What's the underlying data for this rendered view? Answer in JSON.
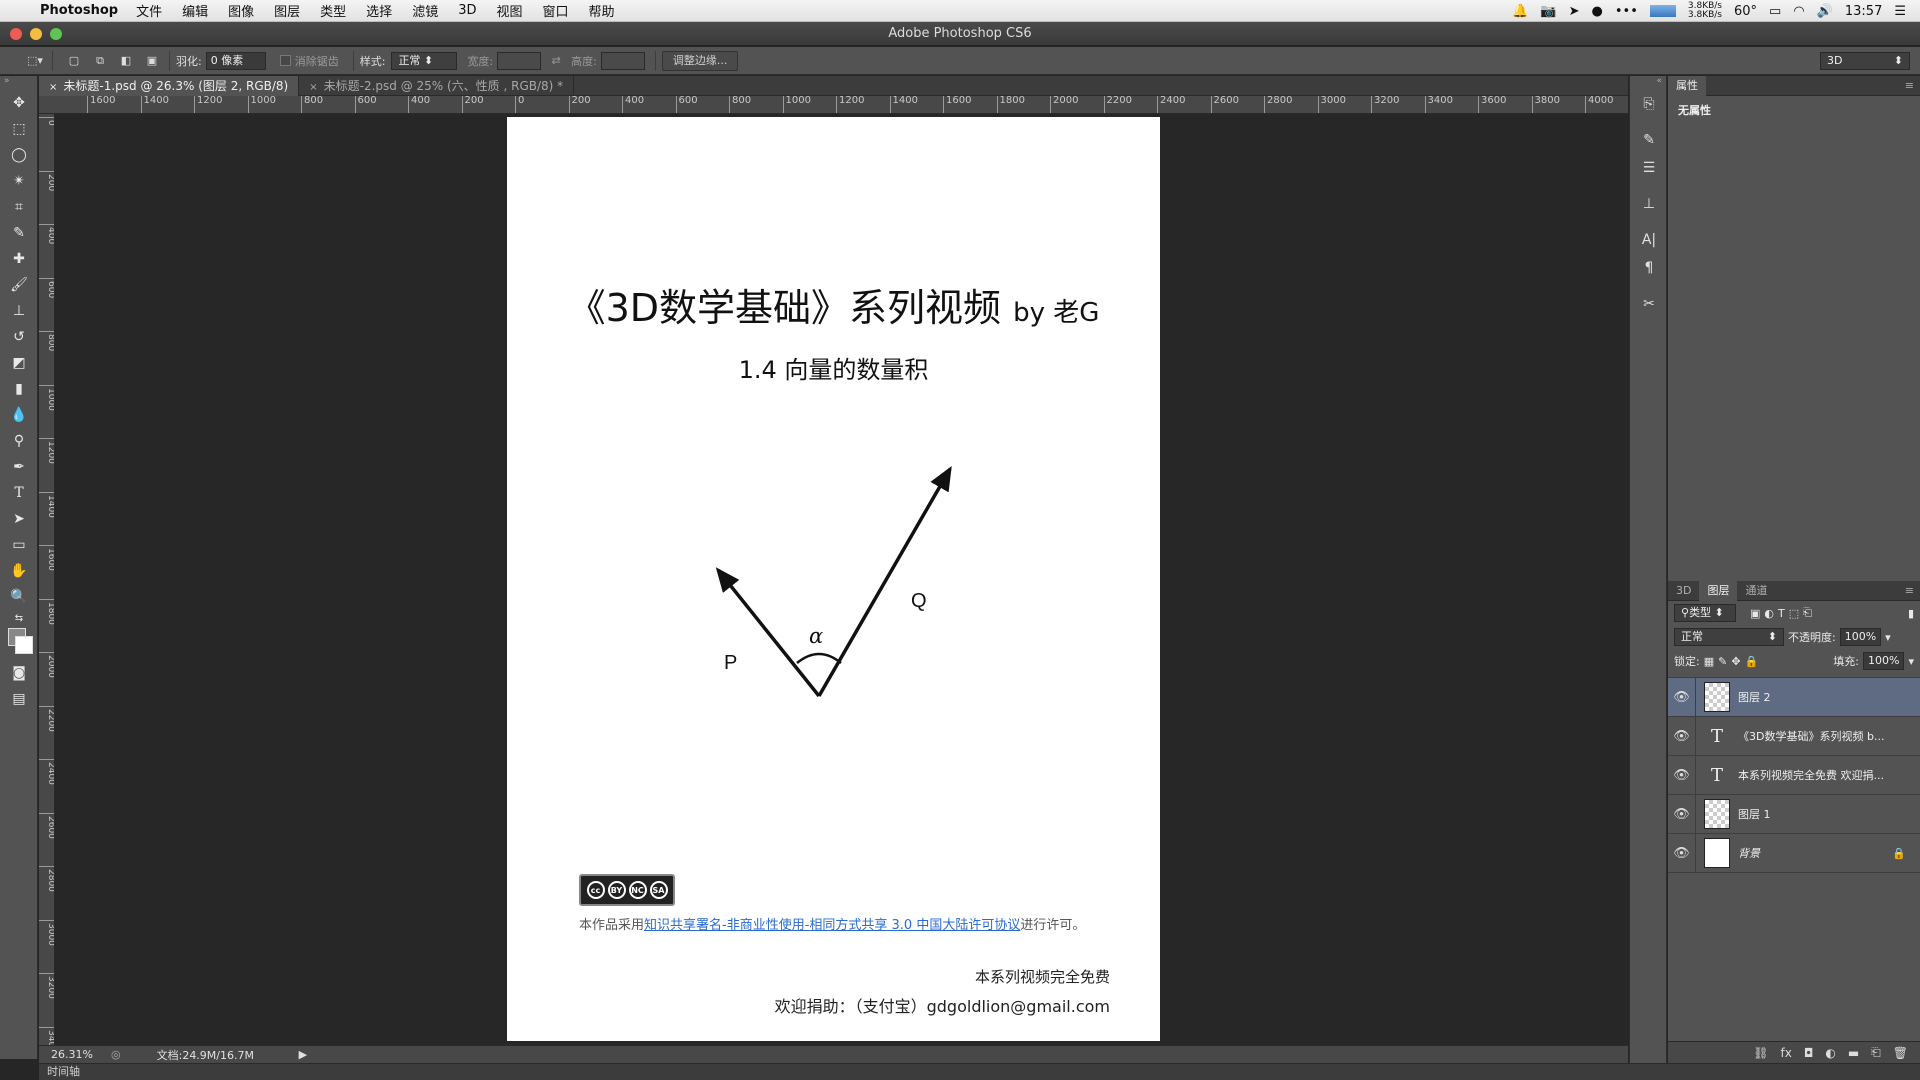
{
  "menubar": {
    "app_name": "Photoshop",
    "menus": [
      "文件",
      "编辑",
      "图像",
      "图层",
      "类型",
      "选择",
      "滤镜",
      "3D",
      "视图",
      "窗口",
      "帮助"
    ],
    "net_up": "3.8KB/s",
    "net_down": "3.8KB/s",
    "temperature": "60°",
    "time": "13:57"
  },
  "window": {
    "title": "Adobe Photoshop CS6"
  },
  "options_bar": {
    "feather_label": "羽化:",
    "feather_value": "0 像素",
    "antialias_label": "消除锯齿",
    "style_label": "样式:",
    "style_value": "正常",
    "width_label": "宽度:",
    "height_label": "高度:",
    "refine_edge_button": "调整边缘...",
    "workspace": "3D"
  },
  "tabs": [
    {
      "label": "未标题-1.psd @ 26.3% (图层 2, RGB/8)",
      "active": true
    },
    {
      "label": "未标题-2.psd @ 25% (六、性质 , RGB/8) *",
      "active": false
    }
  ],
  "ruler_h": [
    "1600",
    "1400",
    "1200",
    "1000",
    "800",
    "600",
    "400",
    "200",
    "0",
    "200",
    "400",
    "600",
    "800",
    "1000",
    "1200",
    "1400",
    "1600",
    "1800",
    "2000",
    "2200",
    "2400",
    "2600",
    "2800",
    "3000",
    "3200",
    "3400",
    "3600",
    "3800",
    "4000"
  ],
  "ruler_v": [
    "0",
    "200",
    "400",
    "600",
    "800",
    "1000",
    "1200",
    "1400",
    "1600",
    "1800",
    "2000",
    "2200",
    "2400",
    "2600",
    "2800",
    "3000",
    "3200",
    "3400"
  ],
  "document": {
    "title": "《3D数学基础》系列视频",
    "title_by": "by 老G",
    "subtitle": "1.4 向量的数量积",
    "diagram": {
      "label_p": "P",
      "label_q": "Q",
      "label_angle": "α"
    },
    "cc_badge": {
      "cc": "cc",
      "by": "BY",
      "nc": "NC",
      "sa": "SA"
    },
    "license_prefix": "本作品采用",
    "license_link": "知识共享署名-非商业性使用-相同方式共享 3.0 中国大陆许可协议",
    "license_suffix": "进行许可。",
    "free_text": "本系列视频完全免费",
    "donate_text": "欢迎捐助：（支付宝）gdgoldlion@gmail.com"
  },
  "status_bar": {
    "zoom": "26.31%",
    "doc_size": "文档:24.9M/16.7M"
  },
  "timeline": {
    "label": "时间轴"
  },
  "properties_panel": {
    "tab": "属性",
    "empty_text": "无属性"
  },
  "layers_panel": {
    "tabs": [
      "3D",
      "图层",
      "通道"
    ],
    "active_tab": "图层",
    "filter_kind": "类型",
    "blend_mode": "正常",
    "opacity_label": "不透明度:",
    "opacity_value": "100%",
    "lock_label": "锁定:",
    "fill_label": "填充:",
    "fill_value": "100%",
    "layers": [
      {
        "name": "图层 2",
        "kind": "pixel",
        "selected": true
      },
      {
        "name": "《3D数学基础》系列视频 b...",
        "kind": "text",
        "selected": false
      },
      {
        "name": "本系列视频完全免费 欢迎捐...",
        "kind": "text",
        "selected": false
      },
      {
        "name": "图层 1",
        "kind": "pixel",
        "selected": false
      },
      {
        "name": "背景",
        "kind": "background",
        "selected": false,
        "locked": true
      }
    ]
  }
}
